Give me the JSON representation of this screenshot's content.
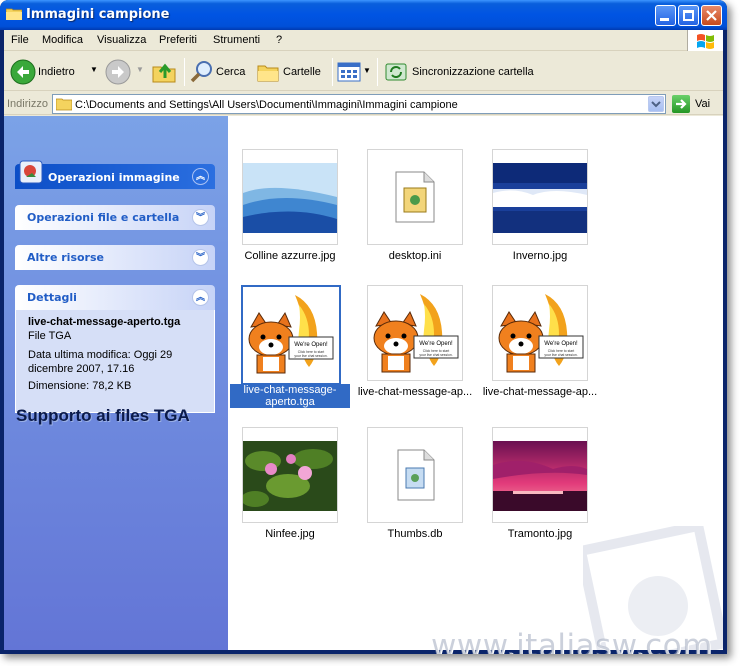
{
  "window": {
    "title": "Immagini campione"
  },
  "menu": [
    "File",
    "Modifica",
    "Visualizza",
    "Preferiti",
    "Strumenti",
    "?"
  ],
  "toolbar": {
    "back_label": "Indietro",
    "search_label": "Cerca",
    "folders_label": "Cartelle",
    "sync_label": "Sincronizzazione cartella"
  },
  "address": {
    "label": "Indirizzo",
    "path": "C:\\Documents and Settings\\All Users\\Documenti\\Immagini\\Immagini campione",
    "go_label": "Vai"
  },
  "sidebar": {
    "panels": [
      {
        "title": "Operazioni immagine"
      },
      {
        "title": "Operazioni file e cartella"
      },
      {
        "title": "Altre risorse"
      },
      {
        "title": "Dettagli"
      }
    ],
    "details": {
      "name": "live-chat-message-aperto.tga",
      "type": "File TGA",
      "modified": "Data ultima modifica: Oggi 29 dicembre 2007, 17.16",
      "size": "Dimensione: 78,2 KB"
    },
    "caption": "Supporto ai files TGA"
  },
  "files": [
    {
      "name": "Colline azzurre.jpg",
      "kind": "hills"
    },
    {
      "name": "desktop.ini",
      "kind": "ini"
    },
    {
      "name": "Inverno.jpg",
      "kind": "winter"
    },
    {
      "name": "live-chat-message-aperto.tga",
      "kind": "fox",
      "selected": true
    },
    {
      "name": "live-chat-message-ap...",
      "kind": "fox"
    },
    {
      "name": "live-chat-message-ap...",
      "kind": "fox"
    },
    {
      "name": "Ninfee.jpg",
      "kind": "lilies"
    },
    {
      "name": "Thumbs.db",
      "kind": "db"
    },
    {
      "name": "Tramonto.jpg",
      "kind": "sunset"
    }
  ],
  "fox_sign": {
    "line1": "We're Open!",
    "line2": "Click here to start your live chat session."
  },
  "watermark": "www.italiasw.com",
  "colors": {
    "title_blue": "#0054e3",
    "selection": "#316ac5",
    "task_pane": "#6375d6"
  }
}
